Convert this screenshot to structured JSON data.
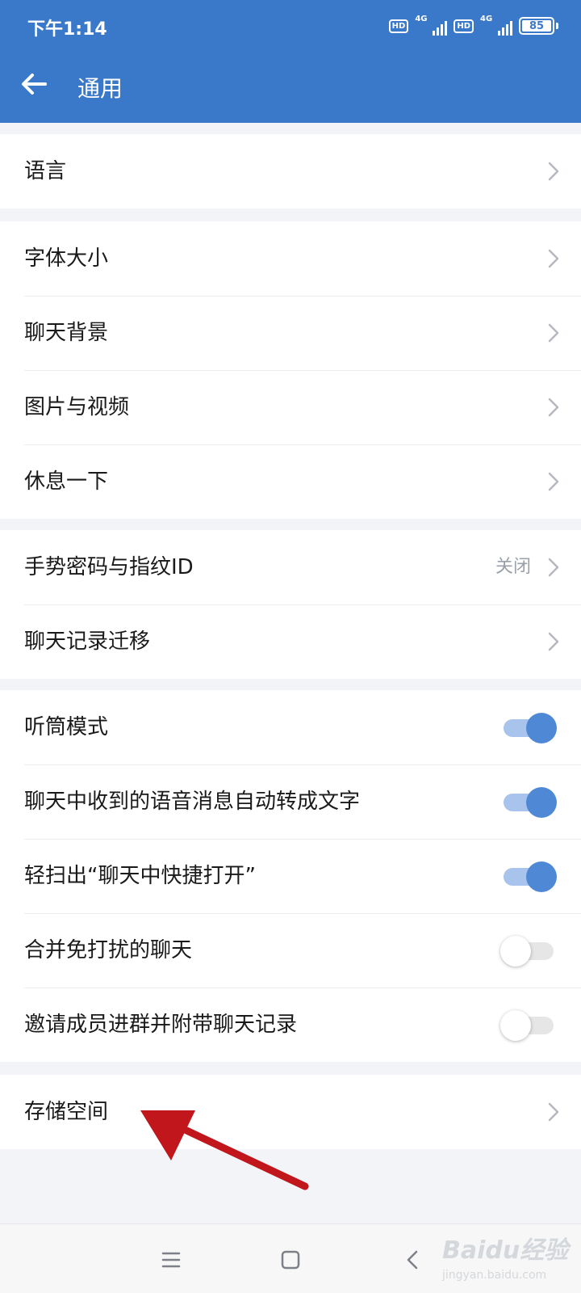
{
  "status_bar": {
    "time": "下午1:14",
    "hd_badge": "HD",
    "network": "4G",
    "battery": "85"
  },
  "header": {
    "title": "通用"
  },
  "groups": [
    {
      "items": [
        {
          "label": "语言",
          "kind": "chevron"
        }
      ]
    },
    {
      "items": [
        {
          "label": "字体大小",
          "kind": "chevron"
        },
        {
          "label": "聊天背景",
          "kind": "chevron"
        },
        {
          "label": "图片与视频",
          "kind": "chevron"
        },
        {
          "label": "休息一下",
          "kind": "chevron"
        }
      ]
    },
    {
      "items": [
        {
          "label": "手势密码与指纹ID",
          "kind": "chevron",
          "value": "关闭"
        },
        {
          "label": "聊天记录迁移",
          "kind": "chevron"
        }
      ]
    },
    {
      "items": [
        {
          "label": "听筒模式",
          "kind": "toggle",
          "on": true
        },
        {
          "label": "聊天中收到的语音消息自动转成文字",
          "kind": "toggle",
          "on": true
        },
        {
          "label": "轻扫出“聊天中快捷打开”",
          "kind": "toggle",
          "on": true
        },
        {
          "label": "合并免打扰的聊天",
          "kind": "toggle",
          "on": false
        },
        {
          "label": "邀请成员进群并附带聊天记录",
          "kind": "toggle",
          "on": false
        }
      ]
    },
    {
      "items": [
        {
          "label": "存储空间",
          "kind": "chevron"
        }
      ]
    }
  ],
  "watermark": {
    "brand": "Baidu经验",
    "url": "jingyan.baidu.com"
  },
  "colors": {
    "primary": "#3a78c9",
    "toggle_on": "#4f88d4",
    "annotation_arrow": "#c0161c"
  }
}
